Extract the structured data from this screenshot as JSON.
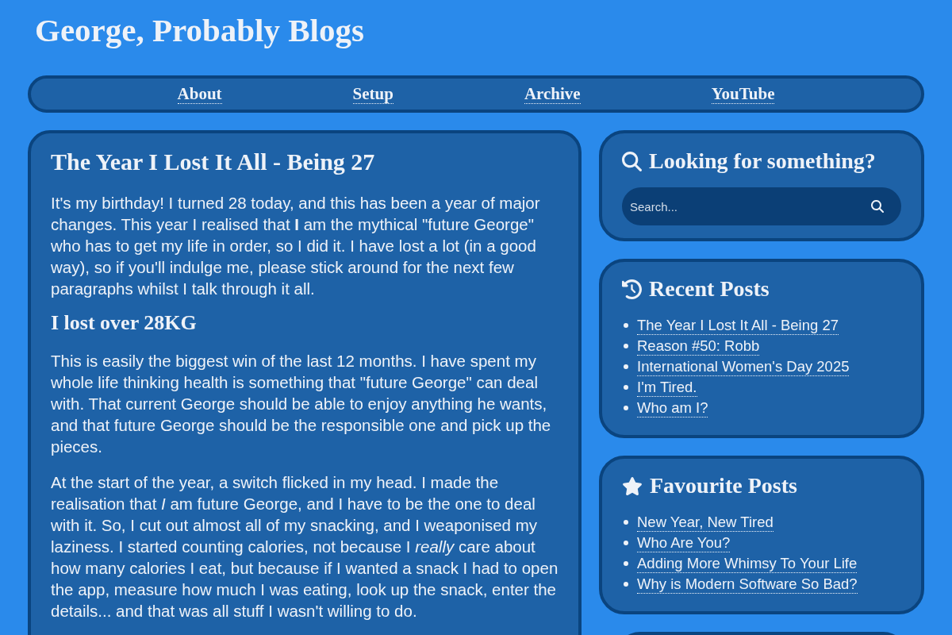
{
  "site": {
    "title": "George, Probably Blogs"
  },
  "nav": {
    "links": [
      "About",
      "Setup",
      "Archive",
      "YouTube"
    ]
  },
  "post": {
    "title": "The Year I Lost It All - Being 27",
    "blocks": [
      {
        "kind": "paragraph",
        "text": "It's my birthday! I turned 28 today, and this has been a year of major changes. This year I realised that **I** am the mythical \"future George\" who has to get my life in order, so I did it. I have lost a lot (in a good way), so if you'll indulge me, please stick around for the next few paragraphs whilst I talk through it all."
      },
      {
        "kind": "heading",
        "text": "I lost over 28KG"
      },
      {
        "kind": "paragraph",
        "text": "This is easily the biggest win of the last 12 months. I have spent my whole life thinking health is something that \"future George\" can deal with. That current George should be able to enjoy anything he wants, and that future George should be the responsible one and pick up the pieces."
      },
      {
        "kind": "paragraph",
        "text": "At the start of the year, a switch flicked in my head. I made the realisation that *I* am future George, and I have to be the one to deal with it. So, I cut out almost all of my snacking, and I weaponised my laziness. I started counting calories, not because I *really* care about how many calories I eat, but because if I wanted a snack I had to open the app, measure how much I was eating, look up the snack, enter the details... and that was all stuff I wasn't willing to do."
      }
    ]
  },
  "sidebar": {
    "search": {
      "title": "Looking for something?",
      "placeholder": "Search..."
    },
    "recent_posts": {
      "title": "Recent Posts",
      "items": [
        "The Year I Lost It All - Being 27",
        "Reason #50: Robb",
        "International Women's Day 2025",
        "I'm Tired.",
        "Who am I?"
      ]
    },
    "favourite_posts": {
      "title": "Favourite Posts",
      "items": [
        "New Year, New Tired",
        "Who Are You?",
        "Adding More Whimsy To Your Life",
        "Why is Modern Software So Bad?"
      ]
    }
  }
}
